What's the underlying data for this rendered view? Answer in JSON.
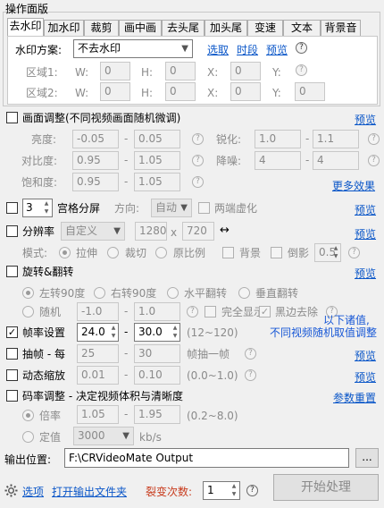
{
  "panel_title": "操作面版",
  "tabs": [
    "去水印",
    "加水印",
    "裁剪",
    "画中画",
    "去头尾",
    "加头尾",
    "变速",
    "文本",
    "背景音"
  ],
  "watermark": {
    "scheme_label": "水印方案:",
    "scheme_value": "不去水印",
    "link_select": "选取",
    "link_time": "时段",
    "link_preview": "预览",
    "region1": "区域1:",
    "region2": "区域2:",
    "w": "W:",
    "h": "H:",
    "x": "X:",
    "y": "Y:",
    "zero": "0"
  },
  "adjust": {
    "label": "画面调整(不同视频画面随机微调)",
    "preview": "预览",
    "brightness": "亮度:",
    "brightness_min": "-0.05",
    "brightness_max": "0.05",
    "contrast": "对比度:",
    "contrast_min": "0.95",
    "contrast_max": "1.05",
    "saturation": "饱和度:",
    "saturation_min": "0.95",
    "saturation_max": "1.05",
    "sharpen": "锐化:",
    "sharpen_min": "1.0",
    "sharpen_max": "1.1",
    "denoise": "降噪:",
    "denoise_min": "4",
    "denoise_max": "4",
    "more": "更多效果"
  },
  "grid": {
    "count": "3",
    "label": "宫格分屏",
    "direction": "方向:",
    "direction_value": "自动",
    "blur": "两端虚化",
    "preview": "预览"
  },
  "resolution": {
    "label": "分辨率",
    "mode_value": "自定义",
    "width": "1280",
    "x": "x",
    "height": "720",
    "arrows": "↔",
    "preview": "预览",
    "mode": "模式:",
    "stretch": "拉伸",
    "crop": "裁切",
    "ratio": "原比例",
    "bg": "背景",
    "shadow": "倒影",
    "shadow_value": "0.5"
  },
  "rotate": {
    "label": "旋转&翻转",
    "preview": "预览",
    "left90": "左转90度",
    "right90": "右转90度",
    "hflip": "水平翻转",
    "vflip": "垂直翻转",
    "random": "随机",
    "min": "-1.0",
    "max": "1.0",
    "full": "完全显示",
    "blackedge": "黑边去除"
  },
  "framerate": {
    "label": "帧率设置",
    "min": "24.0",
    "max": "30.0",
    "range": "(12~120)",
    "note1": "以下诸值,",
    "note2": "不同视频随机取值调整"
  },
  "extract": {
    "label": "抽帧 - 每",
    "a": "25",
    "b": "30",
    "suffix": "帧抽一帧",
    "preview": "预览"
  },
  "zoom": {
    "label": "动态缩放",
    "min": "0.01",
    "max": "0.10",
    "range": "(0.0~1.0)",
    "preview": "预览"
  },
  "bitrate": {
    "label": "码率调整 - 决定视频体积与清晰度",
    "reset": "参数重置",
    "times": "倍率",
    "times_min": "1.05",
    "times_max": "1.95",
    "times_range": "(0.2~8.0)",
    "fixed": "定值",
    "fixed_value": "3000",
    "unit": "kb/s"
  },
  "output": {
    "label": "输出位置:",
    "path": "F:\\CRVideoMate Output",
    "browse": "..."
  },
  "footer": {
    "options": "选项",
    "open_folder": "打开输出文件夹",
    "split_label": "裂变次数:",
    "split_value": "1",
    "start": "开始处理"
  },
  "dash": "-",
  "qmark": "?"
}
